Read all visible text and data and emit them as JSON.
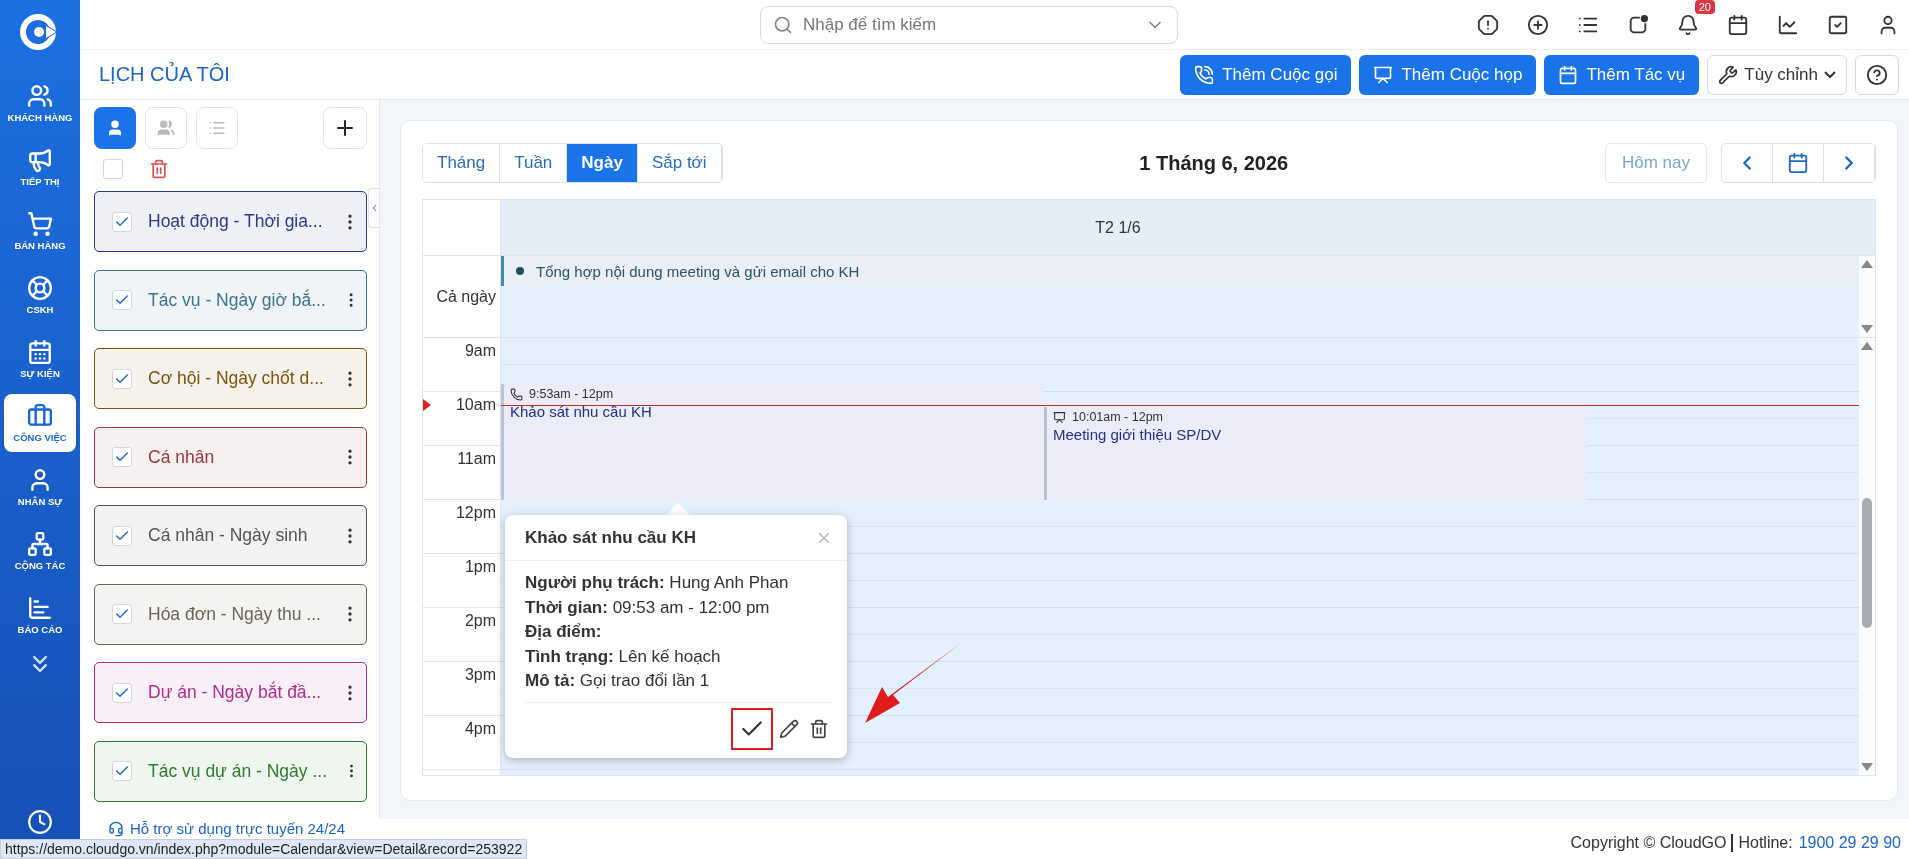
{
  "sidebar": {
    "items": [
      {
        "label": "KHÁCH HÀNG",
        "selected": false
      },
      {
        "label": "TIẾP THỊ",
        "selected": false
      },
      {
        "label": "BÁN HÀNG",
        "selected": false
      },
      {
        "label": "CSKH",
        "selected": false
      },
      {
        "label": "SỰ KIỆN",
        "selected": false
      },
      {
        "label": "CÔNG VIỆC",
        "selected": true
      },
      {
        "label": "NHÂN SỰ",
        "selected": false
      },
      {
        "label": "CỘNG TÁC",
        "selected": false
      },
      {
        "label": "BÁO CÁO",
        "selected": false
      }
    ]
  },
  "search": {
    "placeholder": "Nhập để tìm kiếm"
  },
  "notifications": {
    "badge": "20"
  },
  "page_title": "LỊCH CỦA TÔI",
  "actions": [
    {
      "label": "Thêm Cuộc gọi",
      "kind": "call"
    },
    {
      "label": "Thêm Cuộc họp",
      "kind": "meeting"
    },
    {
      "label": "Thêm Tác vụ",
      "kind": "task"
    }
  ],
  "customize": {
    "label": "Tùy chỉnh"
  },
  "view_toggles": [
    {
      "kind": "user",
      "selected": true
    },
    {
      "kind": "group",
      "selected": false
    },
    {
      "kind": "list",
      "selected": false
    }
  ],
  "select_all": {
    "checked": false
  },
  "calendars": [
    {
      "label": "Hoạt động - Thời gia...",
      "checked": true,
      "color": "#2b3a8f"
    },
    {
      "label": "Tác vụ - Ngày giờ bắ...",
      "checked": true,
      "color": "#3f7390"
    },
    {
      "label": "Cơ hội - Ngày chốt d...",
      "checked": true,
      "color": "#7a5512"
    },
    {
      "label": "Cá nhân",
      "checked": true,
      "color": "#9a3a3a"
    },
    {
      "label": "Cá nhân - Ngày sinh",
      "checked": true,
      "color": "#555555"
    },
    {
      "label": "Hóa đơn - Ngày thu ...",
      "checked": true,
      "color": "#6b6656"
    },
    {
      "label": "Dự án - Ngày bắt đầ...",
      "checked": true,
      "color": "#b02d8c"
    },
    {
      "label": "Tác vụ dự án - Ngày ...",
      "checked": true,
      "color": "#2e7d32"
    }
  ],
  "calendar": {
    "views": [
      {
        "label": "Tháng",
        "selected": false
      },
      {
        "label": "Tuần",
        "selected": false
      },
      {
        "label": "Ngày",
        "selected": true
      },
      {
        "label": "Sắp tới",
        "selected": false
      }
    ],
    "title": "1 Tháng 6, 2026",
    "today": "Hôm nay",
    "day_header": "T2 1/6",
    "all_day_label": "Cả ngày",
    "all_day_events": [
      {
        "title": "Tổng hợp nội dung meeting và gửi email cho KH"
      }
    ],
    "hours": [
      "9am",
      "10am",
      "11am",
      "12pm",
      "1pm",
      "2pm",
      "3pm",
      "4pm"
    ],
    "events": [
      {
        "kind": "call",
        "time": "9:53am - 12pm",
        "title": "Khảo sát nhu cầu KH"
      },
      {
        "kind": "meeting",
        "time": "10:01am - 12pm",
        "title": "Meeting giới thiệu SP/DV"
      }
    ]
  },
  "popup": {
    "title": "Khảo sát nhu cầu KH",
    "fields": [
      "**Người phụ trách:** Hung Anh Phan",
      "**Thời gian:** 09:53 am - 12:00 pm",
      "**Địa điểm:**",
      "**Tình trạng:** Lên kế hoạch",
      "**Mô tả:** Gọi trao đổi lần 1"
    ]
  },
  "footer": {
    "support": "Hỗ trợ sử dụng trực tuyến 24/24",
    "copyright": "Copyright © CloudGO",
    "hotline_label": "Hotline:",
    "hotline": "1900 29 29 90"
  },
  "status_url": "https://demo.cloudgo.vn/index.php?module=Calendar&view=Detail&record=253922"
}
